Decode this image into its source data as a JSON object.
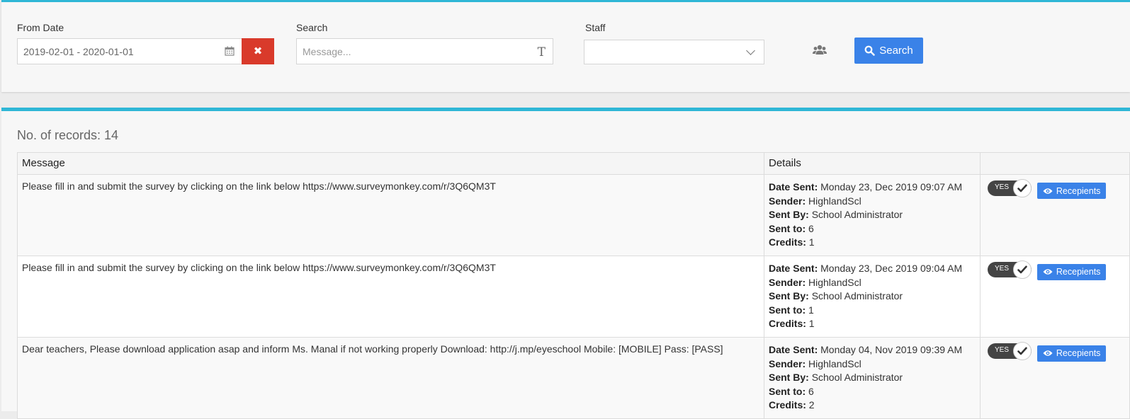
{
  "filters": {
    "from_date_label": "From Date",
    "from_date_value": "2019-02-01 - 2020-01-01",
    "search_label": "Search",
    "search_placeholder": "Message...",
    "staff_label": "Staff",
    "staff_value": "",
    "search_button_label": "Search",
    "clear_icon": "times-icon",
    "calendar_icon": "calendar-icon",
    "text_icon": "text-format-icon",
    "users_icon": "users-icon"
  },
  "results": {
    "records_text": "No. of records: 14",
    "columns": [
      "Message",
      "Details",
      ""
    ],
    "detail_labels": {
      "date_sent": "Date Sent:",
      "sender": "Sender:",
      "sent_by": "Sent By:",
      "sent_to": "Sent to:",
      "credits": "Credits:"
    },
    "toggle_label": "YES",
    "recepients_label": "Recepients",
    "rows": [
      {
        "message": "Please fill in and submit the survey by clicking on the link below https://www.surveymonkey.com/r/3Q6QM3T",
        "date_sent": "Monday 23, Dec 2019 09:07 AM",
        "sender": "HighlandScl",
        "sent_by": "School Administrator",
        "sent_to": "6",
        "credits": "1"
      },
      {
        "message": "Please fill in and submit the survey by clicking on the link below https://www.surveymonkey.com/r/3Q6QM3T",
        "date_sent": "Monday 23, Dec 2019 09:04 AM",
        "sender": "HighlandScl",
        "sent_by": "School Administrator",
        "sent_to": "1",
        "credits": "1"
      },
      {
        "message": "Dear teachers, Please download application asap and inform Ms. Manal if not working properly Download: http://j.mp/eyeschool Mobile: [MOBILE] Pass: [PASS]",
        "date_sent": "Monday 04, Nov 2019 09:39 AM",
        "sender": "HighlandScl",
        "sent_by": "School Administrator",
        "sent_to": "6",
        "credits": "2"
      }
    ]
  },
  "colors": {
    "accent": "#2fb7d6",
    "primary_button": "#3a82e8",
    "danger_button": "#d93a2b",
    "toggle": "#444444"
  }
}
